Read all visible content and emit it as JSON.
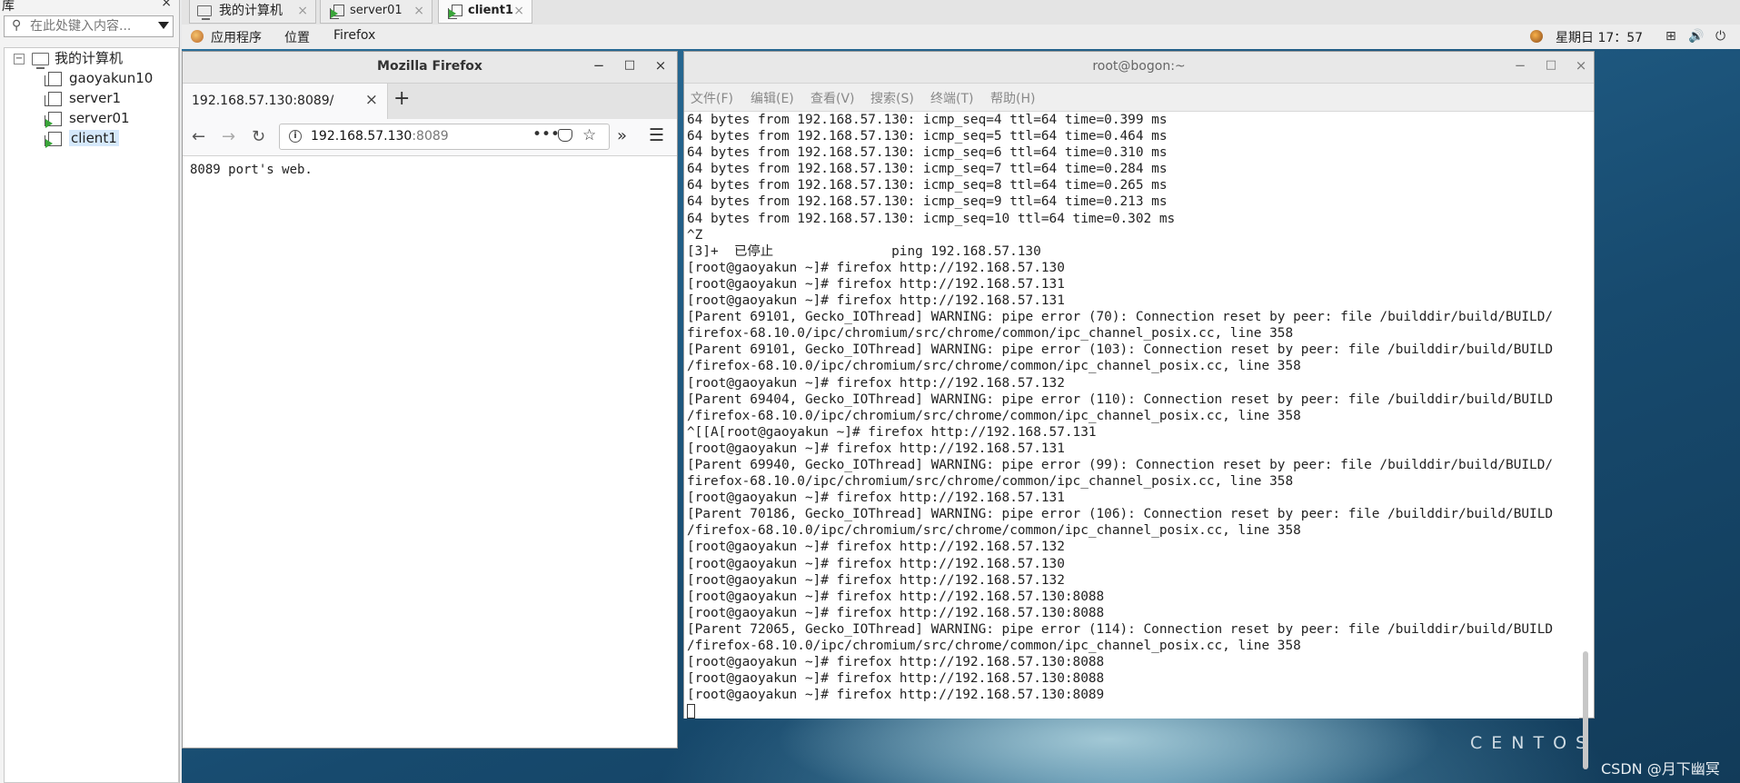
{
  "library": {
    "title": "库",
    "close": "×",
    "search_placeholder": "在此处键入内容...",
    "tree": {
      "root": "我的计算机",
      "expander": "−",
      "vms": [
        "gaoyakun10",
        "server1",
        "server01",
        "client1"
      ]
    }
  },
  "vm_tabs": [
    {
      "label": "我的计算机",
      "close": "×"
    },
    {
      "label": "server01",
      "close": "×"
    },
    {
      "label": "client1",
      "close": "×"
    }
  ],
  "panel": {
    "apps": "应用程序",
    "places": "位置",
    "firefox": "Firefox",
    "clock": "星期日 17：57"
  },
  "firefox": {
    "window_title": "Mozilla Firefox",
    "tab_label": "192.168.57.130:8089/",
    "tab_close": "×",
    "new_tab": "+",
    "url_host": "192.168.57.130",
    "url_port": ":8089",
    "page_text": "8089 port's web.",
    "btn_min": "−",
    "btn_max": "□",
    "btn_close": "×"
  },
  "terminal": {
    "window_title": "root@bogon:~",
    "menu": [
      "文件(F)",
      "编辑(E)",
      "查看(V)",
      "搜索(S)",
      "终端(T)",
      "帮助(H)"
    ],
    "btn_min": "−",
    "btn_max": "□",
    "btn_close": "×",
    "lines": [
      "64 bytes from 192.168.57.130: icmp_seq=4 ttl=64 time=0.399 ms",
      "64 bytes from 192.168.57.130: icmp_seq=5 ttl=64 time=0.464 ms",
      "64 bytes from 192.168.57.130: icmp_seq=6 ttl=64 time=0.310 ms",
      "64 bytes from 192.168.57.130: icmp_seq=7 ttl=64 time=0.284 ms",
      "64 bytes from 192.168.57.130: icmp_seq=8 ttl=64 time=0.265 ms",
      "64 bytes from 192.168.57.130: icmp_seq=9 ttl=64 time=0.213 ms",
      "64 bytes from 192.168.57.130: icmp_seq=10 ttl=64 time=0.302 ms",
      "^Z",
      "[3]+  已停止               ping 192.168.57.130",
      "[root@gaoyakun ~]# firefox http://192.168.57.130",
      "[root@gaoyakun ~]# firefox http://192.168.57.131",
      "[root@gaoyakun ~]# firefox http://192.168.57.131",
      "[Parent 69101, Gecko_IOThread] WARNING: pipe error (70): Connection reset by peer: file /builddir/build/BUILD/",
      "firefox-68.10.0/ipc/chromium/src/chrome/common/ipc_channel_posix.cc, line 358",
      "[Parent 69101, Gecko_IOThread] WARNING: pipe error (103): Connection reset by peer: file /builddir/build/BUILD",
      "/firefox-68.10.0/ipc/chromium/src/chrome/common/ipc_channel_posix.cc, line 358",
      "[root@gaoyakun ~]# firefox http://192.168.57.132",
      "[Parent 69404, Gecko_IOThread] WARNING: pipe error (110): Connection reset by peer: file /builddir/build/BUILD",
      "/firefox-68.10.0/ipc/chromium/src/chrome/common/ipc_channel_posix.cc, line 358",
      "^[[A[root@gaoyakun ~]# firefox http://192.168.57.131",
      "[root@gaoyakun ~]# firefox http://192.168.57.131",
      "[Parent 69940, Gecko_IOThread] WARNING: pipe error (99): Connection reset by peer: file /builddir/build/BUILD/",
      "firefox-68.10.0/ipc/chromium/src/chrome/common/ipc_channel_posix.cc, line 358",
      "[root@gaoyakun ~]# firefox http://192.168.57.131",
      "[Parent 70186, Gecko_IOThread] WARNING: pipe error (106): Connection reset by peer: file /builddir/build/BUILD",
      "/firefox-68.10.0/ipc/chromium/src/chrome/common/ipc_channel_posix.cc, line 358",
      "[root@gaoyakun ~]# firefox http://192.168.57.132",
      "[root@gaoyakun ~]# firefox http://192.168.57.130",
      "[root@gaoyakun ~]# firefox http://192.168.57.132",
      "[root@gaoyakun ~]# firefox http://192.168.57.130:8088",
      "[root@gaoyakun ~]# firefox http://192.168.57.130:8088",
      "[Parent 72065, Gecko_IOThread] WARNING: pipe error (114): Connection reset by peer: file /builddir/build/BUILD",
      "/firefox-68.10.0/ipc/chromium/src/chrome/common/ipc_channel_posix.cc, line 358",
      "[root@gaoyakun ~]# firefox http://192.168.57.130:8088",
      "[root@gaoyakun ~]# firefox http://192.168.57.130:8088",
      "[root@gaoyakun ~]# firefox http://192.168.57.130:8089"
    ]
  },
  "desktop": {
    "centos_label": "CENTOS",
    "watermark": "CSDN @月下幽冥"
  }
}
